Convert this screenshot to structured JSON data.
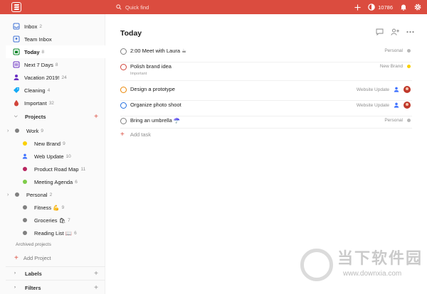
{
  "topbar": {
    "search_placeholder": "Quick find",
    "karma_points": "10786"
  },
  "sidebar": {
    "items": [
      {
        "label": "Inbox",
        "count": "2",
        "icon": "inbox-icon",
        "color": "#4073d6"
      },
      {
        "label": "Team Inbox",
        "count": "",
        "icon": "team-inbox-icon",
        "color": "#4073d6"
      },
      {
        "label": "Today",
        "count": "8",
        "icon": "calendar-today-icon",
        "color": "#058527"
      },
      {
        "label": "Next 7 Days",
        "count": "8",
        "icon": "calendar-week-icon",
        "color": "#692fc2"
      },
      {
        "label": "Vacation 2019!",
        "count": "24",
        "icon": "person-icon",
        "color": "#692fc2"
      },
      {
        "label": "Cleaning",
        "count": "4",
        "icon": "tag-icon",
        "color": "#14aaf5"
      },
      {
        "label": "Important",
        "count": "32",
        "icon": "drop-icon",
        "color": "#d1453b"
      }
    ],
    "projects_label": "Projects",
    "projects": [
      {
        "label": "Work",
        "count": "9",
        "color": "#808080",
        "level": 0,
        "collapsible": true
      },
      {
        "label": "New Brand",
        "count": "9",
        "color": "#fad000",
        "level": 1
      },
      {
        "label": "Web Update",
        "count": "10",
        "color": "#4073ff",
        "level": 1,
        "icon": "person-icon"
      },
      {
        "label": "Product Road Map",
        "count": "11",
        "color": "#b8255f",
        "level": 1
      },
      {
        "label": "Meeting Agenda",
        "count": "6",
        "color": "#7ecc49",
        "level": 1
      },
      {
        "label": "Personal",
        "count": "2",
        "color": "#808080",
        "level": 0,
        "collapsible": true
      },
      {
        "label": "Fitness 💪",
        "count": "9",
        "color": "#808080",
        "level": 1
      },
      {
        "label": "Groceries 🛍",
        "count": "7",
        "color": "#808080",
        "level": 1
      },
      {
        "label": "Reading List 📖",
        "count": "6",
        "color": "#808080",
        "level": 1
      }
    ],
    "archived_label": "Archived projects",
    "add_project_label": "Add Project",
    "labels_label": "Labels",
    "filters_label": "Filters"
  },
  "main": {
    "title": "Today",
    "tasks": [
      {
        "text": "2:00 Meet with Laura ☕",
        "sub": "",
        "project": "Personal",
        "project_color": "#b8b8b8",
        "priority_color": "#808080",
        "assignee": ""
      },
      {
        "text": "Polish brand idea",
        "sub": "Important",
        "project": "New Brand",
        "project_color": "#fad000",
        "priority_color": "#d1453b",
        "assignee": ""
      },
      {
        "text": "Design a prototype",
        "sub": "",
        "project": "Website Update",
        "project_color": "#4073ff",
        "priority_color": "#eb8909",
        "assignee": "avatar"
      },
      {
        "text": "Organize photo shoot",
        "sub": "",
        "project": "Website Update",
        "project_color": "#4073ff",
        "priority_color": "#246fe0",
        "assignee": "avatar"
      },
      {
        "text": "Bring an umbrella ☂️",
        "sub": "",
        "project": "Personal",
        "project_color": "#b8b8b8",
        "priority_color": "#808080",
        "assignee": ""
      }
    ],
    "add_task_label": "Add task"
  },
  "watermark": {
    "text": "当下软件园",
    "url": "www.downxia.com"
  },
  "colors": {
    "accent": "#db4c3f",
    "sidebar_bg": "#fafafa"
  }
}
